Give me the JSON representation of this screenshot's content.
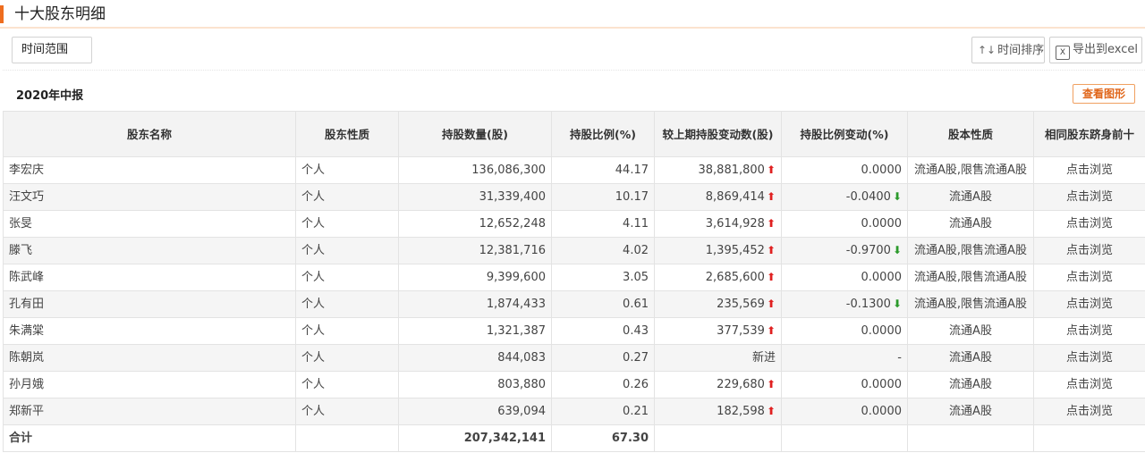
{
  "header": {
    "title": "十大股东明细"
  },
  "toolbar": {
    "range_label": "时间范围",
    "sort_label": "时间排序",
    "export_label": "导出到excel",
    "excel_icon_text": "X"
  },
  "report": {
    "period": "2020年中报",
    "chart_button": "查看图形"
  },
  "table": {
    "headers": [
      "股东名称",
      "股东性质",
      "持股数量(股)",
      "持股比例(%)",
      "较上期持股变动数(股)",
      "持股比例变动(%)",
      "股本性质",
      "相同股东跻身前十"
    ],
    "rows": [
      {
        "name": "李宏庆",
        "nature": "个人",
        "shares": "136,086,300",
        "ratio": "44.17",
        "change": "38,881,800",
        "change_dir": "up",
        "ratio_change": "0.0000",
        "ratio_dir": "flat",
        "share_type": "流通A股,限售流通A股",
        "link": "点击浏览"
      },
      {
        "name": "汪文巧",
        "nature": "个人",
        "shares": "31,339,400",
        "ratio": "10.17",
        "change": "8,869,414",
        "change_dir": "up",
        "ratio_change": "-0.0400",
        "ratio_dir": "down",
        "share_type": "流通A股",
        "link": "点击浏览"
      },
      {
        "name": "张旻",
        "nature": "个人",
        "shares": "12,652,248",
        "ratio": "4.11",
        "change": "3,614,928",
        "change_dir": "up",
        "ratio_change": "0.0000",
        "ratio_dir": "flat",
        "share_type": "流通A股",
        "link": "点击浏览"
      },
      {
        "name": "滕飞",
        "nature": "个人",
        "shares": "12,381,716",
        "ratio": "4.02",
        "change": "1,395,452",
        "change_dir": "up",
        "ratio_change": "-0.9700",
        "ratio_dir": "down",
        "share_type": "流通A股,限售流通A股",
        "link": "点击浏览"
      },
      {
        "name": "陈武峰",
        "nature": "个人",
        "shares": "9,399,600",
        "ratio": "3.05",
        "change": "2,685,600",
        "change_dir": "up",
        "ratio_change": "0.0000",
        "ratio_dir": "flat",
        "share_type": "流通A股,限售流通A股",
        "link": "点击浏览"
      },
      {
        "name": "孔有田",
        "nature": "个人",
        "shares": "1,874,433",
        "ratio": "0.61",
        "change": "235,569",
        "change_dir": "up",
        "ratio_change": "-0.1300",
        "ratio_dir": "down",
        "share_type": "流通A股,限售流通A股",
        "link": "点击浏览"
      },
      {
        "name": "朱满棠",
        "nature": "个人",
        "shares": "1,321,387",
        "ratio": "0.43",
        "change": "377,539",
        "change_dir": "up",
        "ratio_change": "0.0000",
        "ratio_dir": "flat",
        "share_type": "流通A股",
        "link": "点击浏览"
      },
      {
        "name": "陈朝岚",
        "nature": "个人",
        "shares": "844,083",
        "ratio": "0.27",
        "change": "新进",
        "change_dir": "new",
        "ratio_change": "-",
        "ratio_dir": "none",
        "share_type": "流通A股",
        "link": "点击浏览"
      },
      {
        "name": "孙月娥",
        "nature": "个人",
        "shares": "803,880",
        "ratio": "0.26",
        "change": "229,680",
        "change_dir": "up",
        "ratio_change": "0.0000",
        "ratio_dir": "flat",
        "share_type": "流通A股",
        "link": "点击浏览"
      },
      {
        "name": "郑新平",
        "nature": "个人",
        "shares": "639,094",
        "ratio": "0.21",
        "change": "182,598",
        "change_dir": "up",
        "ratio_change": "0.0000",
        "ratio_dir": "flat",
        "share_type": "流通A股",
        "link": "点击浏览"
      }
    ],
    "total": {
      "label": "合计",
      "shares": "207,342,141",
      "ratio": "67.30"
    }
  },
  "colors": {
    "accent": "#ee6d1f",
    "up": "#e02020",
    "down": "#2b9a2b",
    "link": "#2a5caa"
  },
  "icons": {
    "up": "arrow-up-icon",
    "down": "arrow-down-icon",
    "sort": "sort-icon",
    "excel": "excel-icon"
  }
}
